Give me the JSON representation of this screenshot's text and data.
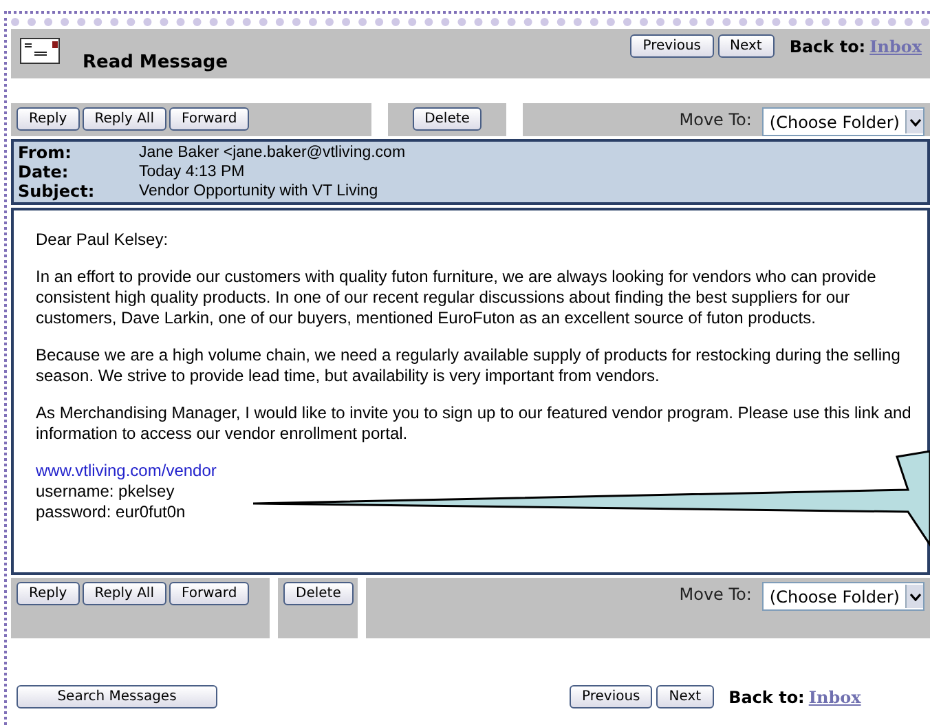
{
  "window": {
    "title": "Read Message"
  },
  "top_nav": {
    "buttons": [
      "Previous",
      "Next"
    ],
    "back_label": "Back to:",
    "back_link": "Inbox"
  },
  "toolbars": [
    {
      "reply_buttons": [
        "Reply",
        "Reply All",
        "Forward"
      ],
      "delete": "Delete",
      "move_label": "Move To:",
      "folder": "(Choose Folder)"
    },
    {
      "reply_buttons": [
        "Reply",
        "Reply All",
        "Forward"
      ],
      "delete": "Delete",
      "move_label": "Move To:",
      "folder": "(Choose Folder)"
    }
  ],
  "message": {
    "fields": [
      {
        "label": "From:",
        "value": "Jane Baker <jane.baker@vtliving.com"
      },
      {
        "label": "Date:",
        "value": "Today 4:13 PM"
      },
      {
        "label": "Subject:",
        "value": "Vendor Opportunity with VT Living"
      }
    ],
    "greeting": "Dear Paul Kelsey:",
    "paragraphs": [
      "In an effort to provide our customers with quality futon furniture, we are always looking for vendors who can provide consistent high quality products.  In one of our recent regular discussions about finding the best suppliers for our customers, Dave Larkin, one of our buyers, mentioned EuroFuton as an excellent source of futon products.",
      "Because we are a high volume chain, we need a regularly available supply of products for restocking during the selling season.  We strive to provide lead time, but availability is very important from vendors.",
      "As Merchandising Manager, I would like to invite you to sign up to our featured vendor program.  Please use this link and information to access our vendor enrollment portal."
    ],
    "link": "www.vtliving.com/vendor",
    "lines": [
      "username: pkelsey",
      "password: eur0fut0n"
    ]
  },
  "bottom": {
    "search": "Search Messages",
    "buttons": [
      "Previous",
      "Next"
    ],
    "back_label": "Back to:",
    "back_link": "Inbox"
  }
}
